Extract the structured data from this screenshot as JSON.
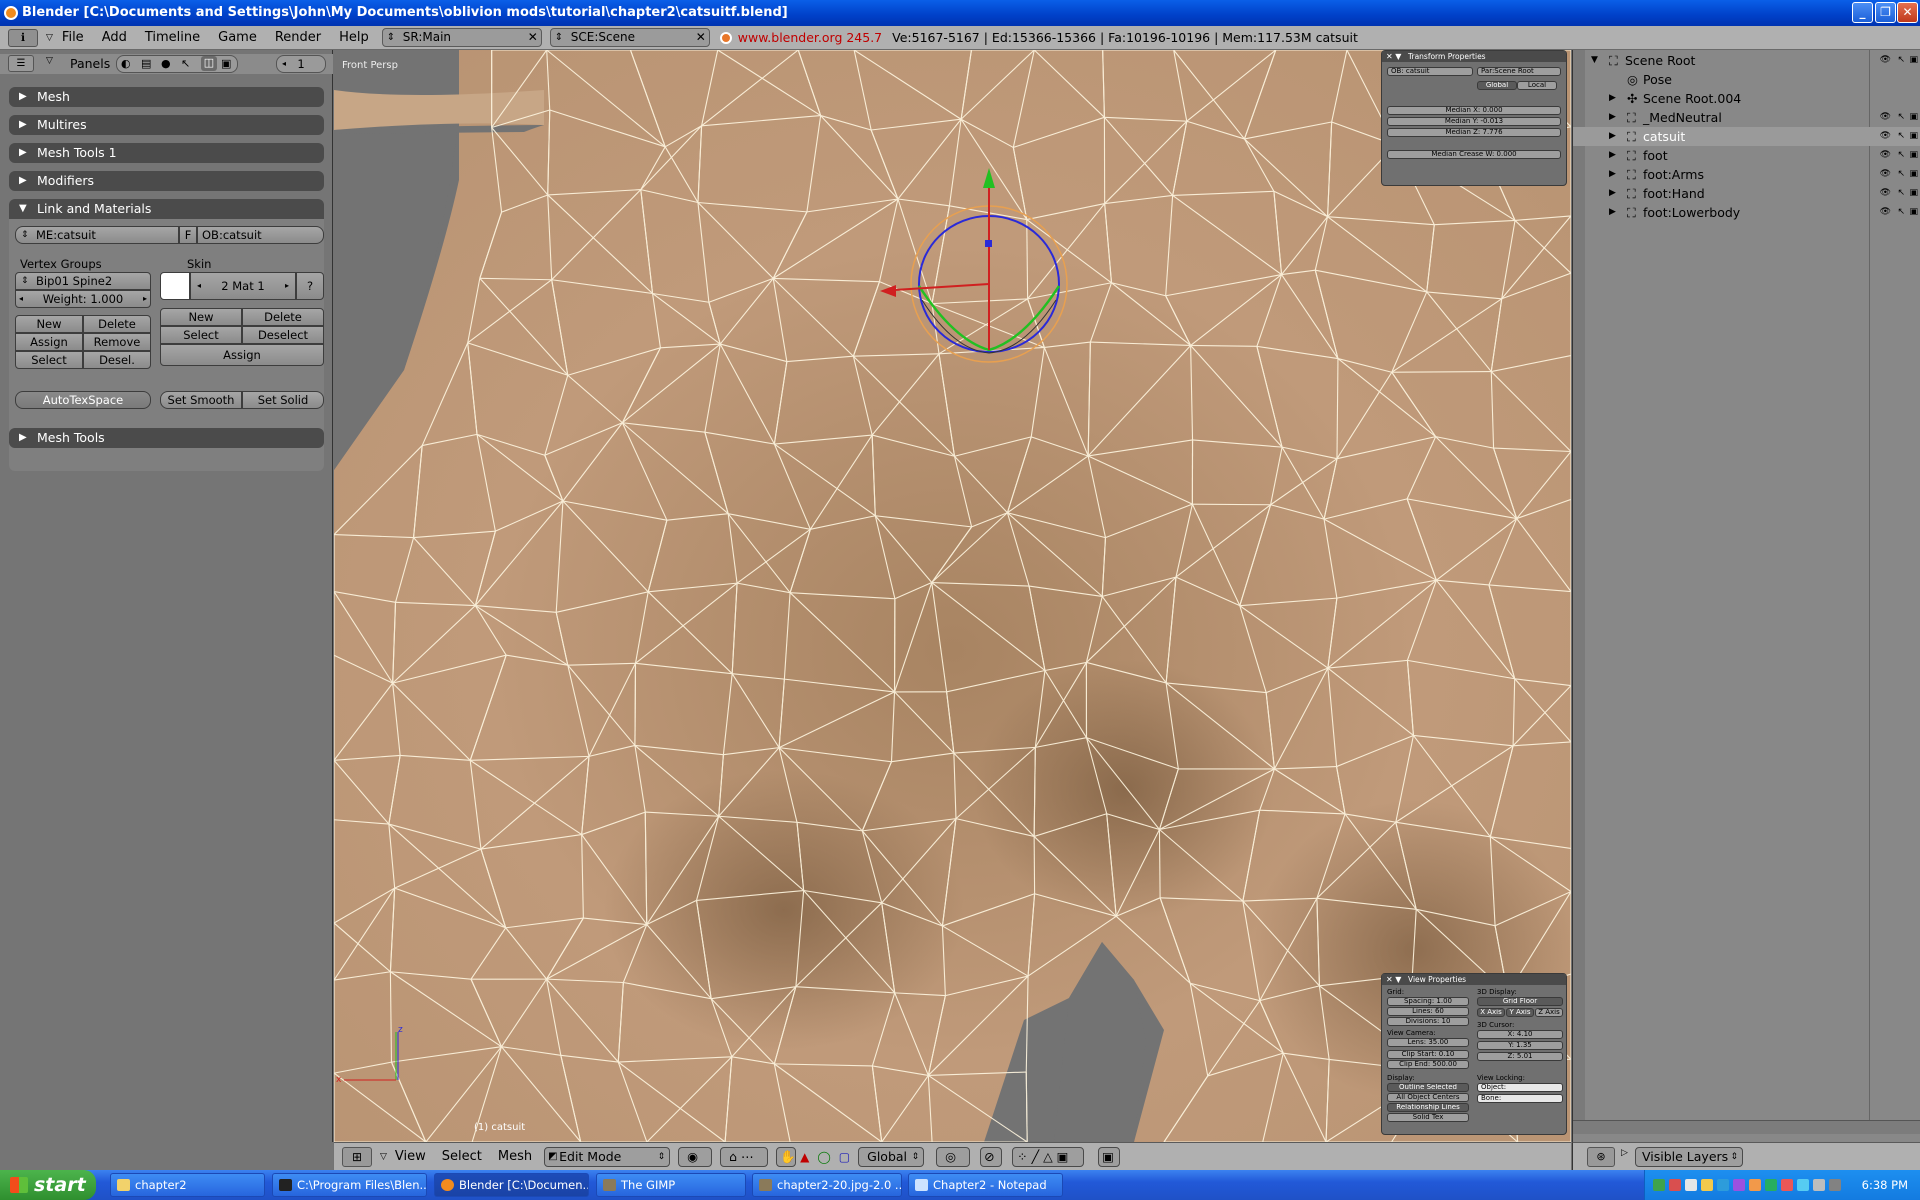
{
  "window": {
    "title": "Blender [C:\\Documents and Settings\\John\\My Documents\\oblivion mods\\tutorial\\chapter2\\catsuitf.blend]",
    "buttons": [
      "_",
      "❐",
      "✕"
    ]
  },
  "header": {
    "menus": [
      "File",
      "Add",
      "Timeline",
      "Game",
      "Render",
      "Help"
    ],
    "screen": "SR:Main",
    "scene": "SCE:Scene",
    "url": "www.blender.org 245.7",
    "stats": "Ve:5167-5167 | Ed:15366-15366 | Fa:10196-10196 | Mem:117.53M catsuit"
  },
  "left_panel": {
    "toolbar_label": "Panels",
    "toolbar_value": "1",
    "tabs": {
      "mesh": "Mesh",
      "multires": "Multires",
      "mesh_tools_1": "Mesh Tools 1",
      "modifiers": "Modifiers",
      "link_materials": "Link and Materials",
      "mesh_tools": "Mesh Tools"
    },
    "link": {
      "me_field": "ME:catsuit",
      "f_button": "F",
      "ob_field": "OB:catsuit",
      "vertex_groups_label": "Vertex Groups",
      "vertex_group": "Bip01 Spine2",
      "weight": "Weight: 1.000",
      "vg_new": "New",
      "vg_delete": "Delete",
      "vg_assign": "Assign",
      "vg_remove": "Remove",
      "vg_select": "Select",
      "vg_desel": "Desel.",
      "skin_label": "Skin",
      "mat_field": "2 Mat 1",
      "mat_help": "?",
      "mat_new": "New",
      "mat_delete": "Delete",
      "mat_select": "Select",
      "mat_deselect": "Deselect",
      "mat_assign": "Assign",
      "autotexspace": "AutoTexSpace",
      "set_smooth": "Set Smooth",
      "set_solid": "Set Solid"
    }
  },
  "viewport": {
    "view_label": "Front Persp",
    "object_label": "(1) catsuit",
    "transform": {
      "title": "Transform Properties",
      "ob": "OB: catsuit",
      "par": "Par:Scene Root",
      "global": "Global",
      "local": "Local",
      "median_x": "Median X: 0.000",
      "median_y": "Median Y: -0.013",
      "median_z": "Median Z: 7.776",
      "median_crease": "Median Crease W: 0.000"
    },
    "view_props": {
      "title": "View Properties",
      "grid_label": "Grid:",
      "spacing": "Spacing: 1.00",
      "lines": "Lines: 60",
      "divisions": "Divisions: 10",
      "display3d_label": "3D Display:",
      "grid_floor": "Grid Floor",
      "x_axis": "X Axis",
      "y_axis": "Y Axis",
      "z_axis": "Z Axis",
      "view_camera_label": "View Camera:",
      "lens": "Lens: 35.00",
      "clip_start": "Clip Start: 0.10",
      "clip_end": "Clip End: 500.00",
      "cursor_label": "3D Cursor:",
      "cx": "X: 4.10",
      "cy": "Y: 1.35",
      "cz": "Z: 5.01",
      "display_label": "Display:",
      "outline_selected": "Outline Selected",
      "all_object_centers": "All Object Centers",
      "relationship_lines": "Relationship Lines",
      "solid_tex": "Solid Tex",
      "view_locking_label": "View Locking:",
      "object_field": "Object:",
      "bone_field": "Bone:"
    },
    "bottom": {
      "view": "View",
      "select": "Select",
      "mesh": "Mesh",
      "mode": "Edit Mode",
      "orientation": "Global"
    }
  },
  "outliner": {
    "items": [
      {
        "name": "Scene Root"
      },
      {
        "name": "Pose"
      },
      {
        "name": "Scene Root.004"
      },
      {
        "name": "_MedNeutral"
      },
      {
        "name": "catsuit"
      },
      {
        "name": "foot"
      },
      {
        "name": "foot:Arms"
      },
      {
        "name": "foot:Hand"
      },
      {
        "name": "foot:Lowerbody"
      }
    ],
    "visible_layers": "Visible Layers"
  },
  "taskbar": {
    "start": "start",
    "tasks": [
      "chapter2",
      "C:\\Program Files\\Blen...",
      "Blender [C:\\Documen...",
      "The GIMP",
      "chapter2-20.jpg-2.0 ...",
      "Chapter2 - Notepad"
    ],
    "clock": "6:38 PM"
  },
  "colors": {
    "skin": "#b58f6e",
    "wire": "#fff6e0",
    "panel": "#757575",
    "accent_red": "#c00000"
  }
}
